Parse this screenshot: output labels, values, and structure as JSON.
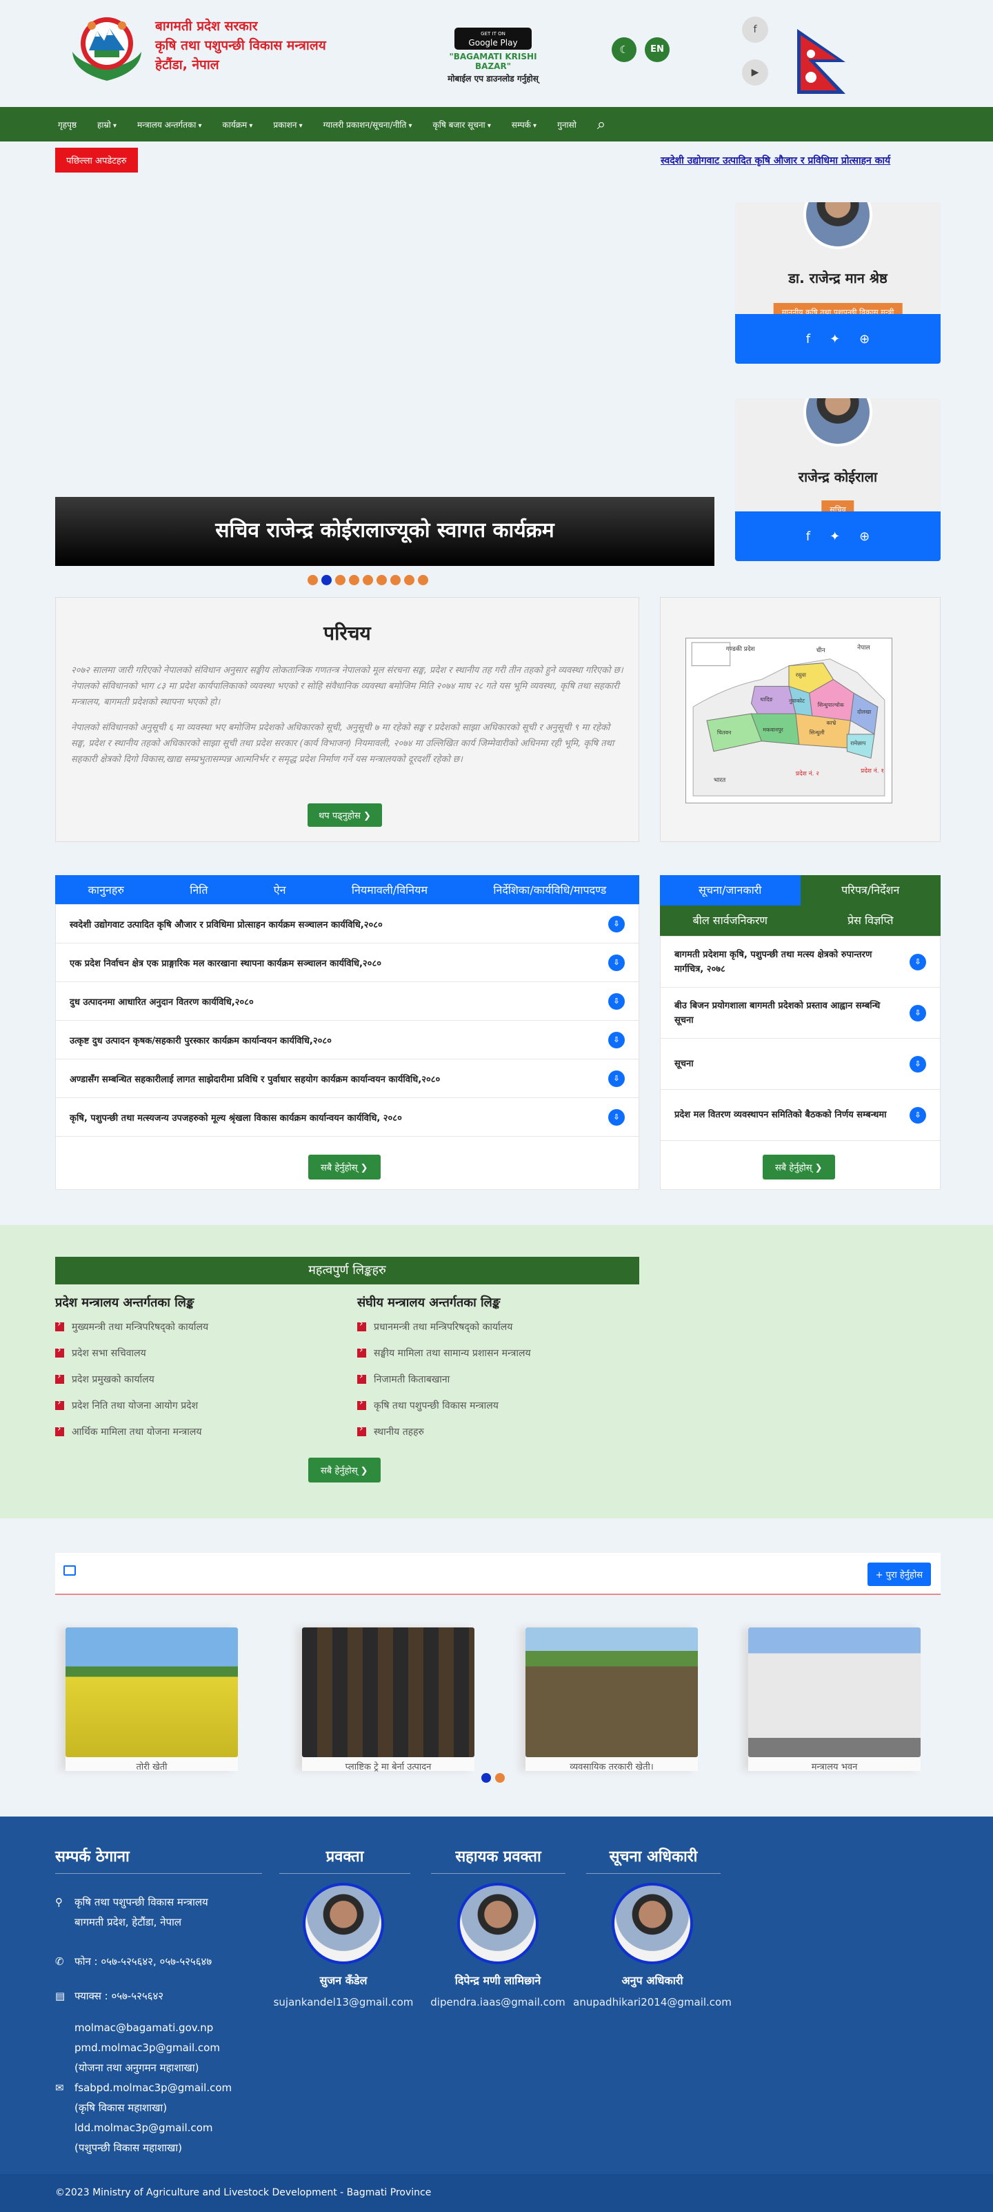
{
  "header": {
    "org_line1": "बागमती प्रदेश सरकार",
    "org_line2": "कृषि तथा पशुपन्छी विकास मन्त्रालय",
    "org_line3": "हेटौंडा, नेपाल",
    "gplay_small": "GET IT ON",
    "gplay_big": "Google Play",
    "app_name": "\"BAGAMATI KRISHI BAZAR\"",
    "download_text": "मोबाईल एप डाउनलोड गर्नुहोस्",
    "lang_label": "EN"
  },
  "nav": {
    "items": [
      "गृहपृष्ठ",
      "हाम्रो",
      "मन्त्रालय अन्तर्गतका",
      "कार्यक्रम",
      "प्रकाशन",
      "ग्यालरी प्रकाशन/सूचना/नीति",
      "कृषि बजार सूचना",
      "सम्पर्क",
      "गुनासो"
    ]
  },
  "updates": {
    "label": "पछिल्ला अपडेटहरु",
    "ticker": "स्वदेशी उद्योगवाट उत्पादित कृषि औजार र प्रविधिमा प्रोत्साहन कार्य"
  },
  "slider": {
    "caption": "सचिव राजेन्द्र कोईरालाज्यूको स्वागत कार्यक्रम"
  },
  "officials": [
    {
      "name": "डा. राजेन्द्र मान श्रेष्ठ",
      "role": "माननीय कृषि तथा पशुपन्छी विकास मन्त्री"
    },
    {
      "name": "राजेन्द्र कोईराला",
      "role": "सचिव"
    }
  ],
  "intro": {
    "title": "परिचय",
    "para1": "२०७२ सालमा जारी गरिएको नेपालको संविधान अनुसार सङ्घीय लोकतान्त्रिक गणतन्त्र नेपालको मूल संरचना सङ्घ, प्रदेश र स्थानीय तह गरी तीन तहको हुने व्यवस्था गरिएको छ। नेपालको संविधानको भाग ८३ मा प्रदेश कार्यपालिकाको व्यवस्था भएको र सोहि संवैधानिक व्यवस्था बमोजिम मिति २०७४ माघ २८ गते यस भूमि व्यवस्था, कृषि तथा सहकारी मन्त्रालय, बागमती प्रदेशको स्थापना भएको हो।",
    "para2": "नेपालको संविधानको अनुसूची ६ मा व्यवस्था भए बमोजिम प्रदेशको अधिकारको सूची, अनुसूची ७ मा रहेको सङ्घ र प्रदेशको साझा अधिकारको सूची र अनुसूची ९ मा रहेको सङ्घ, प्रदेश र स्थानीय तहको अधिकारको साझा सूची तथा प्रदेश सरकार (कार्य विभाजन) नियमावली, २०७४ मा उल्लिखित कार्य जिम्मेवारीको अधिनमा रही भूमि, कृषि तथा सहकारी क्षेत्रको दिगो विकास,खाद्य सम्प्रभुतासम्पन्न आत्मनिर्भर र समृद्ध प्रदेश निर्माण गर्ने यस मन्त्रालयको दूरदर्शी रहेको छ।",
    "readmore": "थप पढ्नुहोस"
  },
  "map": {
    "labels": [
      "गण्डकी प्रदेश",
      "नेपाल",
      "चीन",
      "रसुवा",
      "धादिङ",
      "नुवाकोट",
      "सिन्धुपाल्चोक",
      "दोलखा",
      "रामेछाप",
      "चितवन",
      "मकवानपुर",
      "सिन्धुली",
      "काभ्रे",
      "प्रदेश नं. १",
      "भारत",
      "प्रदेश नं. २"
    ]
  },
  "laws": {
    "tabs": [
      "कानुनहरु",
      "निति",
      "ऐन",
      "नियमावली/विनियम",
      "निर्देशिका/कार्यविधि/मापदण्ड"
    ],
    "rows": [
      "स्वदेशी उद्योगवाट उत्पादित कृषि औजार र प्रविधिमा प्रोत्साहन कार्यक्रम सञ्चालन कार्यविधि,२०८०",
      "एक प्रदेश निर्वाचन क्षेत्र एक प्राङ्गारिक मल कारखाना स्थापना कार्यक्रम सञ्चालन कार्यविधि,२०८०",
      "दुध उत्पादनमा आधारित अनुदान वितरण कार्यविधि,२०८०",
      "उत्कृष्ट दुध उत्पादन कृषक/सहकारी पुरस्कार कार्यक्रम कार्यान्वयन कार्यविधि,२०८०",
      "अण्डासँग सम्बन्धित सहकारीलाई लागत साझेदारीमा प्रविधि र पुर्वाधार सहयोग कार्यक्रम कार्यान्वयन कार्यविधि,२०८०",
      "कृषि, पशुपन्छी तथा मत्स्यजन्य उपजहरुको मूल्य श्रृंखला विकास कार्यक्रम कार्यान्वयन कार्यविधि, २०८०"
    ],
    "view_all": "सबै हेर्नुहोस्"
  },
  "notices": {
    "tabs": [
      "सूचना/जानकारी",
      "परिपत्र/निर्देशन",
      "बील सार्वजनिकरण",
      "प्रेस विज्ञप्ति"
    ],
    "rows": [
      "बागमती प्रदेशमा कृषि, पशुपन्छी तथा मत्स्य क्षेत्रको रुपान्तरण मार्गचित्र, २०७८",
      "बीउ बिजन प्रयोगशाला बागमती प्रदेशको प्रस्ताव आह्वान सम्बन्धि सूचना",
      "सूचना",
      "प्रदेश मल वितरण व्यवस्थापन समितिको बैठकको निर्णय सम्बन्धमा"
    ],
    "view_all": "सबै हेर्नुहोस्"
  },
  "links": {
    "title": "महत्वपुर्ण लिङ्कहरु",
    "col1_title": "प्रदेश मन्त्रालय अन्तर्गतका लिङ्क",
    "col1": [
      "मुख्यमन्त्री तथा मन्त्रिपरिषद्को कार्यालय",
      "प्रदेश सभा सचिवालय",
      "प्रदेश प्रमुखको कार्यालय",
      "प्रदेश निति तथा योजना आयोग प्रदेश",
      "आर्थिक मामिला तथा योजना मन्त्रालय"
    ],
    "col2_title": "संघीय मन्त्रालय अन्तर्गतका लिङ्क",
    "col2": [
      "प्रधानमन्त्री तथा मन्त्रिपरिषद्को कार्यालय",
      "सङ्घीय मामिला तथा सामान्य प्रशासन मन्त्रालय",
      "निजामती किताबखाना",
      "कृषि तथा पशुपन्छी विकास मन्त्रालय",
      "स्थानीय तहहरु"
    ],
    "view_all": "सबै हेर्नुहोस्"
  },
  "gallery": {
    "view_all": "+ पुरा हेर्नुहोस",
    "items": [
      "तोरी खेती",
      "प्लाष्टिक ट्रे मा बेर्ना उत्पादन",
      "व्यवसायिक तरकारी खेती।",
      "मन्त्रालय भवन"
    ]
  },
  "footer": {
    "contact_title": "सम्पर्क ठेगाना",
    "address1": "कृषि तथा पशुपन्छी विकास मन्त्रालय",
    "address2": "बागमती प्रदेश, हेटौंडा, नेपाल",
    "phone": "फोन : ०५७-५२५६४२, ०५७-५२५६४७",
    "fax": "फ्याक्स : ०५७-५२५६४२",
    "emails": [
      "molmac@bagamati.gov.np",
      "pmd.molmac3p@gmail.com",
      "(योजना तथा अनुगमन महाशाखा)",
      "fsabpd.molmac3p@gmail.com",
      "(कृषि विकास महाशाखा)",
      "ldd.molmac3p@gmail.com",
      "(पशुपन्छी विकास महाशाखा)"
    ],
    "people": [
      {
        "title": "प्रवक्ता",
        "name": "सुजन कँडेल",
        "email": "sujankandel13@gmail.com"
      },
      {
        "title": "सहायक प्रवक्ता",
        "name": "दिपेन्द्र मणी लामिछाने",
        "email": "dipendra.iaas@gmail.com"
      },
      {
        "title": "सूचना अधिकारी",
        "name": "अनुप अधिकारी",
        "email": "anupadhikari2014@gmail.com"
      }
    ],
    "copyright": "©2023 Ministry of Agriculture and Livestock Development - Bagmati Province"
  },
  "colors": {
    "nav_green": "#2e6b2b",
    "primary_blue": "#0d6efd",
    "accent_red": "#d8232a",
    "accent_orange": "#e8833a",
    "footer_blue": "#1f5598"
  }
}
